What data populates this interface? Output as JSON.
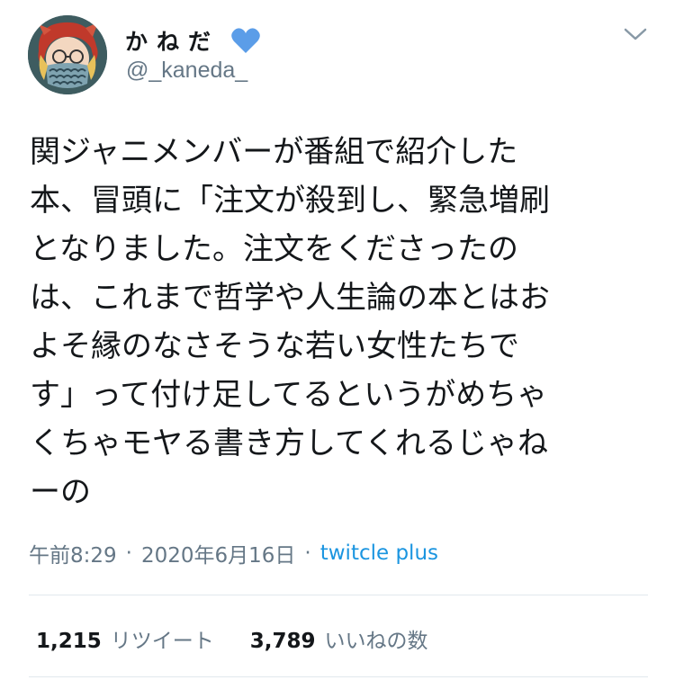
{
  "author": {
    "display_name": "かねだ",
    "handle": "@_kaneda_",
    "badge_icon": "blue-heart-icon",
    "avatar_icon": "cartoon-avatar-icon"
  },
  "menu_icon": "chevron-down-icon",
  "tweet": {
    "lines": [
      "関ジャニメンバーが番組で紹介した",
      "本、冒頭に「注文が殺到し、緊急増刷",
      "となりました。注文をくださったの",
      "は、これまで哲学や人生論の本とはお",
      "よそ縁のなさそうな若い女性たちで",
      "す」って付け足してるというがめちゃ",
      "くちゃモヤる書き方してくれるじゃね",
      "ーの"
    ]
  },
  "meta": {
    "time": "午前8:29",
    "separator": "·",
    "date": "2020年6月16日",
    "client": "twitcle plus"
  },
  "stats": {
    "retweets_count": "1,215",
    "retweets_label": "リツイート",
    "likes_count": "3,789",
    "likes_label": "いいねの数"
  },
  "colors": {
    "text": "#14171a",
    "secondary": "#657786",
    "link": "#1b95e0",
    "divider": "#e1e8ed",
    "heart": "#5b9de8"
  }
}
